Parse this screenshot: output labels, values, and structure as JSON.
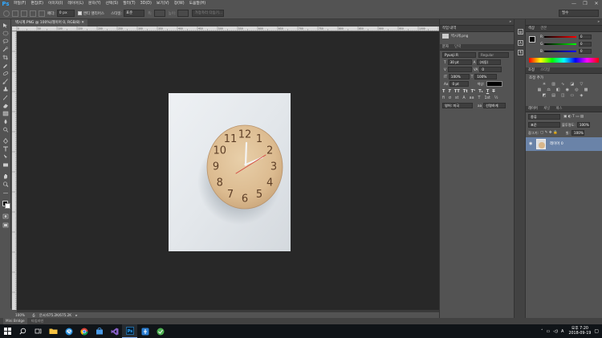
{
  "app": {
    "logo": "Ps",
    "menu": [
      "파일(F)",
      "편집(E)",
      "이미지(I)",
      "레이어(L)",
      "문자(Y)",
      "선택(S)",
      "필터(T)",
      "3D(D)",
      "보기(V)",
      "창(W)",
      "도움말(H)"
    ],
    "window_controls": [
      "—",
      "❐",
      "✕"
    ]
  },
  "options_bar": {
    "feather_label": "페더:",
    "feather_value": "0 px",
    "antialias_label": "앤티 앨리어스",
    "style_label": "스타일:",
    "style_value": "표준",
    "width_label": "폭:",
    "height_label": "높이:",
    "refine_edge": "가장자리 다듬기...",
    "workspace": "필수"
  },
  "document": {
    "tab_title": "벽시계.PNG @ 100%(레이어 0, RGB/8)",
    "zoom": "100%",
    "doc_size": "문서:675.2K/675.2K",
    "ruler_ticks_top": [
      "0",
      "50",
      "100",
      "150",
      "200",
      "250",
      "300",
      "350",
      "400",
      "450",
      "500",
      "550",
      "600",
      "650",
      "700",
      "750",
      "800",
      "850",
      "900",
      "950",
      "1000"
    ]
  },
  "bottom_tabs": [
    "Mini Bridge",
    "타임라인"
  ],
  "history_panel": {
    "tabs": [
      "작업 내역"
    ],
    "item": "벽시계.png"
  },
  "character_panel": {
    "tabs": [
      "문자",
      "단락"
    ],
    "font_family": "Pyunji R",
    "font_style": "Regular",
    "font_size": "30 pt",
    "leading": "(자동)",
    "tracking": "0",
    "vertical_scale": "100%",
    "horizontal_scale": "100%",
    "baseline_shift": "0 pt",
    "color_label": "색상:",
    "language": "영어: 미국",
    "antialias": "선명하게"
  },
  "color_panel": {
    "tabs": [
      "색상",
      "견본"
    ],
    "r_label": "R",
    "g_label": "G",
    "b_label": "B",
    "r": "0",
    "g": "0",
    "b": "0"
  },
  "adjustments_panel": {
    "tabs": [
      "조정",
      "스타일"
    ],
    "title": "조정 추가"
  },
  "layers_panel": {
    "tabs": [
      "레이어",
      "채널",
      "패스"
    ],
    "kind_label": "종류",
    "blend_mode": "표준",
    "opacity_label": "불투명도:",
    "opacity": "100%",
    "lock_label": "잠그기:",
    "fill_label": "칠:",
    "fill": "100%",
    "layer_name": "레이어 0"
  },
  "clock": {
    "numbers": [
      "12",
      "1",
      "2",
      "3",
      "4",
      "5",
      "6",
      "7",
      "8",
      "9",
      "10",
      "11"
    ]
  },
  "taskbar": {
    "time": "오후 7:20",
    "date": "2018-09-19",
    "lang": "A"
  }
}
